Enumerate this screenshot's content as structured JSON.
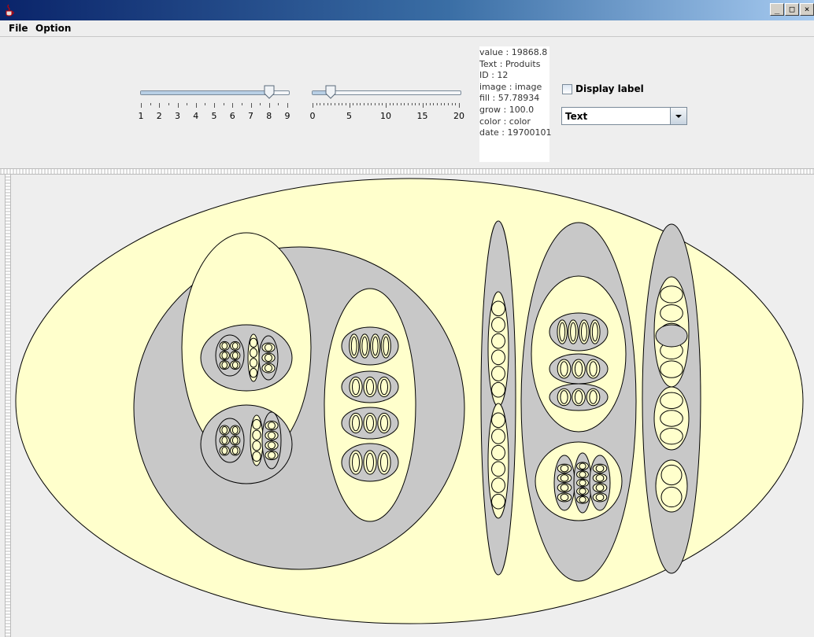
{
  "window": {
    "minimize_glyph": "_",
    "maximize_glyph": "□",
    "close_glyph": "×"
  },
  "menu": {
    "items": [
      "File",
      "Option"
    ]
  },
  "sliders": [
    {
      "ticks": [
        "1",
        "2",
        "3",
        "4",
        "5",
        "6",
        "7",
        "8",
        "9"
      ],
      "value": 8,
      "min": 1,
      "max": 9
    },
    {
      "ticks": [
        "0",
        "5",
        "10",
        "15",
        "20"
      ],
      "value": 2.5,
      "min": 0,
      "max": 20
    }
  ],
  "info": {
    "lines": [
      "value : 19868.8",
      "Text : Produits",
      "ID : 12",
      "image : image",
      "fill : 57.78934",
      "grow : 100.0",
      "color : color",
      "date : 19700101"
    ]
  },
  "display_label": {
    "label": "Display label",
    "checked": false
  },
  "select": {
    "value": "Text"
  },
  "colors": {
    "outer_fill": "#ffffcc",
    "inner_fill": "#c8c8c8",
    "stroke": "#000000",
    "title_gradient_start": "#0a246a"
  },
  "icons": {
    "app": "java-cup-icon",
    "dropdown": "chevron-down-icon"
  }
}
